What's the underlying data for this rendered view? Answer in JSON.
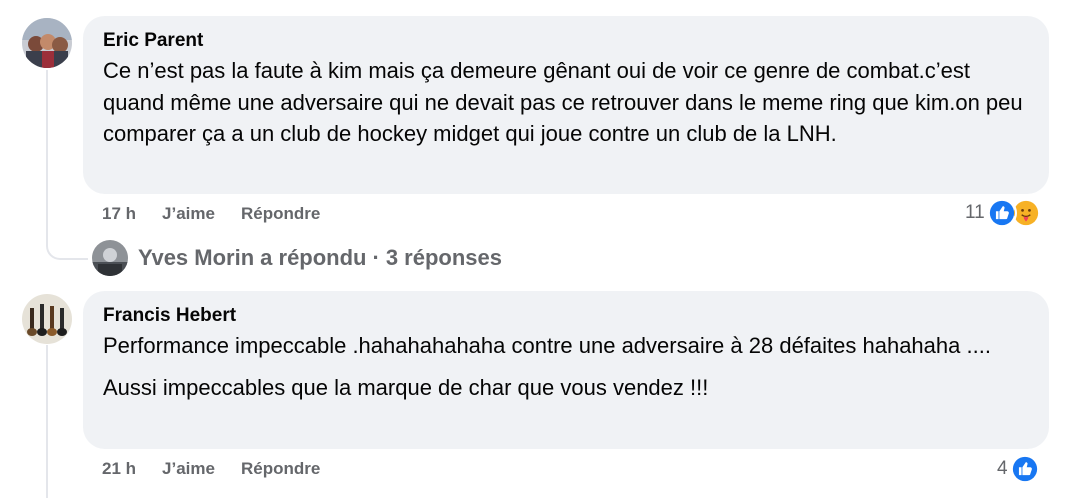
{
  "comments": [
    {
      "author": "Eric Parent",
      "text": "Ce n’est pas la faute à kim mais ça demeure gênant oui de voir ce genre de combat.c’est quand même une adversaire qui ne devait pas ce retrouver dans le meme ring que kim.on peu comparer ça a un club de hockey midget qui joue contre un club de la LNH.",
      "time": "17 h",
      "like_label": "J’aime",
      "reply_label": "Répondre",
      "reaction_count": "11",
      "reaction_icons": [
        "like-icon",
        "care-icon"
      ]
    },
    {
      "author": "Francis Hebert",
      "text": "Performance impeccable .hahahahahaha contre une adversaire à 28 défaites hahahaha ....",
      "text2": "Aussi impeccables que la marque de char que vous vendez !!!",
      "time": "21 h",
      "like_label": "J’aime",
      "reply_label": "Répondre",
      "reaction_count": "4",
      "reaction_icons": [
        "like-icon"
      ]
    }
  ],
  "replies_summary": {
    "name": "Yves Morin",
    "action": "a répondu",
    "separator": "·",
    "count_label": "3 réponses"
  },
  "colors": {
    "bubble": "#f0f2f5",
    "meta": "#65676b",
    "like_blue": "#1877f2",
    "care_yellow": "#f7b125"
  }
}
